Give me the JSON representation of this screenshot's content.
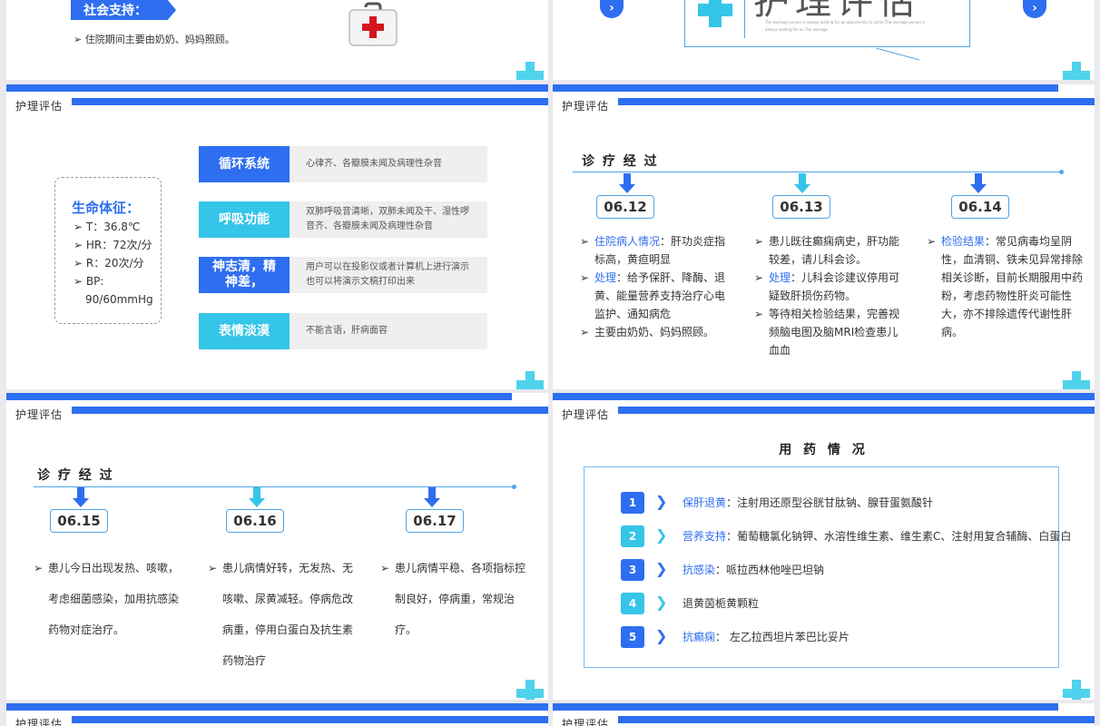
{
  "header_label": "护理评估",
  "slide1": {
    "tag": "社会支持：",
    "line": "➢ 住院期间主要由奶奶、妈妈照顾。"
  },
  "slide2": {
    "title": "护理评估",
    "small_text_1": "The average person is always waiting for an opportunity to come.The average person is",
    "small_text_2": "always waiting for an.The average.",
    "nav_left": "›",
    "nav_right": "›"
  },
  "slide3": {
    "vitals_title": "生命体征：",
    "vitals": [
      "T：36.8℃",
      "HR：72次/分",
      "R：20次/分",
      "BP:",
      "90/60mmHg"
    ],
    "systems": [
      {
        "name": "循环系统",
        "desc": "心律齐、各瓣膜未闻及病理性杂音"
      },
      {
        "name": "呼吸功能",
        "desc": "双肺呼吸音清晰，双肺未闻及干、湿性啰音齐、各瓣膜未闻及病理性杂音"
      },
      {
        "name": "神志清，精神差，",
        "desc": "用户可以在投影仪或者计算机上进行演示也可以将演示文稿打印出来"
      },
      {
        "name": "表情淡漠",
        "desc": "不能言语，肝病面容"
      }
    ]
  },
  "slide4": {
    "title": "诊 疗 经 过",
    "dates": [
      "06.12",
      "06.13",
      "06.14"
    ],
    "col1": [
      {
        "label": "住院病人情况",
        "text": "：肝功炎症指标高，黄疸明显"
      },
      {
        "label": "处理",
        "text": "：给予保肝、降酶、退黄、能量营养支持治疗心电监护、通知病危"
      },
      {
        "label": "",
        "text": "主要由奶奶、妈妈照顾。"
      }
    ],
    "col2": [
      {
        "label": "",
        "text": "患儿既往癫痫病史，肝功能较差，请儿科会诊。"
      },
      {
        "label": "处理",
        "text": "：儿科会诊建议停用可疑致肝损伤药物。"
      },
      {
        "label": "",
        "text": "等待相关检验结果，完善视频脑电图及脑MRI检查患儿血血"
      }
    ],
    "col3": [
      {
        "label": "检验结果",
        "text": "：常见病毒均呈阴性，血清铜、铁未见异常排除相关诊断，目前长期服用中药粉，考虑药物性肝炎可能性大，亦不排除遗传代谢性肝病。"
      }
    ]
  },
  "slide5": {
    "title": "诊 疗 经 过",
    "dates": [
      "06.15",
      "06.16",
      "06.17"
    ],
    "col1": "患儿今日出现发热、咳嗽，考虑细菌感染，加用抗感染药物对症治疗。",
    "col2": "患儿病情好转，无发热、无咳嗽、尿黄减轻。停病危改病重，停用白蛋白及抗生素药物治疗",
    "col3": "患儿病情平稳、各项指标控制良好，停病重，常规治疗。"
  },
  "slide6": {
    "title": "用 药 情 况",
    "items": [
      {
        "num": "1",
        "label": "保肝退黄",
        "text": "：注射用还原型谷胱甘肽钠、腺苷蛋氨酸针"
      },
      {
        "num": "2",
        "label": "营养支持",
        "text": "：葡萄糖氯化钠钾、水溶性维生素、维生素C、注射用复合辅酶、白蛋白"
      },
      {
        "num": "3",
        "label": "抗感染",
        "text": "：哌拉西林他唑巴坦钠"
      },
      {
        "num": "4",
        "label": "",
        "text": "退黄茵栀黄颗粒"
      },
      {
        "num": "5",
        "label": "抗癫痫",
        "text": "：  左乙拉西坦片苯巴比妥片"
      }
    ]
  },
  "colors": {
    "blue": "#2e6ef0",
    "cyan": "#35c5e8",
    "light_cyan": "#4fd2ec"
  }
}
